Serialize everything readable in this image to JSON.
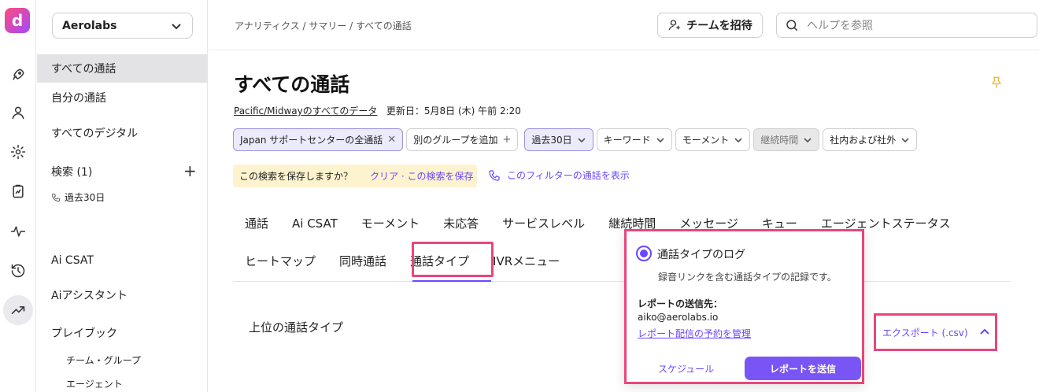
{
  "colors": {
    "accent": "#6b46ff",
    "highlight": "#e8467b",
    "pin": "#e8b530",
    "banner": "#fdf3cf"
  },
  "rail": {
    "logo_letter": "d",
    "icons": [
      "rocket-icon",
      "user-icon",
      "gear-icon",
      "clipboard-icon",
      "pulse-icon",
      "history-icon",
      "trend-icon"
    ]
  },
  "sidebar": {
    "org_name": "Aerolabs",
    "items": [
      "すべての通話",
      "自分の通話",
      "すべてのデジタル"
    ],
    "search_label": "検索 (1)",
    "saved_search": "過去30日",
    "lower_items": [
      "Ai CSAT",
      "Aiアシスタント",
      "プレイブック"
    ],
    "sub_items": [
      "チーム・グループ",
      "エージェント"
    ]
  },
  "topbar": {
    "breadcrumb": "アナリティクス / サマリー / すべての通話",
    "invite_label": "チームを招待",
    "help_placeholder": "ヘルプを参照"
  },
  "page": {
    "title": "すべての通話",
    "data_source": "Pacific/Midwayのすべてのデータ",
    "updated": "更新日：5月8日 (木) 午前 2:20"
  },
  "filters": {
    "group": "Japan サポートセンターの全通話",
    "add_group": "別のグループを追加",
    "date": "過去30日",
    "keyword": "キーワード",
    "moment": "モーメント",
    "duration": "継続時間",
    "scope": "社内および社外"
  },
  "save_search": {
    "question": "この検索を保存しますか？",
    "action": "クリア · この検索を保存"
  },
  "show_calls_label": "このフィルターの通話を表示",
  "tabs_row1": [
    "通話",
    "Ai CSAT",
    "モーメント",
    "未応答",
    "サービスレベル",
    "継続時間",
    "メッセージ",
    "キュー",
    "エージェントステータス"
  ],
  "tabs_row2": [
    "ヒートマップ",
    "同時通話",
    "通話タイプ",
    "IVRメニュー"
  ],
  "active_tab": "通話タイプ",
  "section_title": "上位の通話タイプ",
  "popup": {
    "title": "通話タイプのログ",
    "description": "録音リンクを含む通話タイプの記録です。",
    "send_to_label": "レポートの送信先：",
    "email": "aiko@aerolabs.io",
    "manage_link": "レポート配信の予約を管理",
    "schedule_label": "スケジュール",
    "send_label": "レポートを送信"
  },
  "export_label": "エクスポート (.csv)"
}
